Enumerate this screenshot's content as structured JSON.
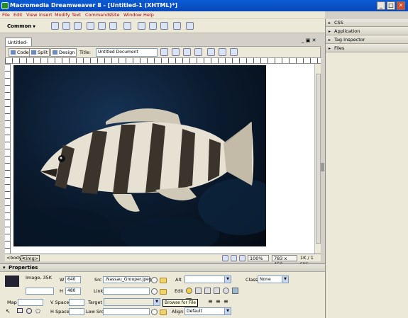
{
  "window": {
    "title": "Macromedia Dreamweaver 8 - [Untitled-1 (XHTML)*]",
    "minimize": "_",
    "maximize": "□",
    "close": "✕"
  },
  "menu": [
    "File",
    "Edit",
    "View",
    "Insert",
    "Modify",
    "Text",
    "Commands",
    "Site",
    "Window",
    "Help"
  ],
  "insert_bar": {
    "category": "Common"
  },
  "panels": [
    "CSS",
    "Application",
    "Tag Inspector",
    "Files"
  ],
  "document": {
    "tab": "Untitled-1*",
    "views": {
      "code": "Code",
      "split": "Split",
      "design": "Design"
    },
    "title_label": "Title:",
    "title_value": "Untitled Document",
    "image_alt": "Nassau Grouper"
  },
  "statusbar": {
    "tags": [
      "<body>",
      "<img>"
    ],
    "zoom": "100%",
    "dimensions": "783 x 459",
    "download": "1K / 1 sec"
  },
  "properties": {
    "header": "Properties",
    "type": "Image, 35K",
    "w_label": "W",
    "w_value": "640",
    "h_label": "H",
    "h_value": "480",
    "src_label": "Src",
    "src_value": ".Nassau_Grouper.jpeg",
    "alt_label": "Alt",
    "alt_value": "",
    "class_label": "Class",
    "class_value": "None",
    "link_label": "Link",
    "link_value": "",
    "edit_label": "Edit",
    "map_label": "Map",
    "map_value": "",
    "vspace_label": "V Space",
    "vspace_value": "",
    "target_label": "Target",
    "target_value": "",
    "hspace_label": "H Space",
    "hspace_value": "",
    "lowsrc_label": "Low Src",
    "lowsrc_value": "",
    "align_label": "Align",
    "align_value": "Default",
    "tooltip": "Browse for File"
  }
}
